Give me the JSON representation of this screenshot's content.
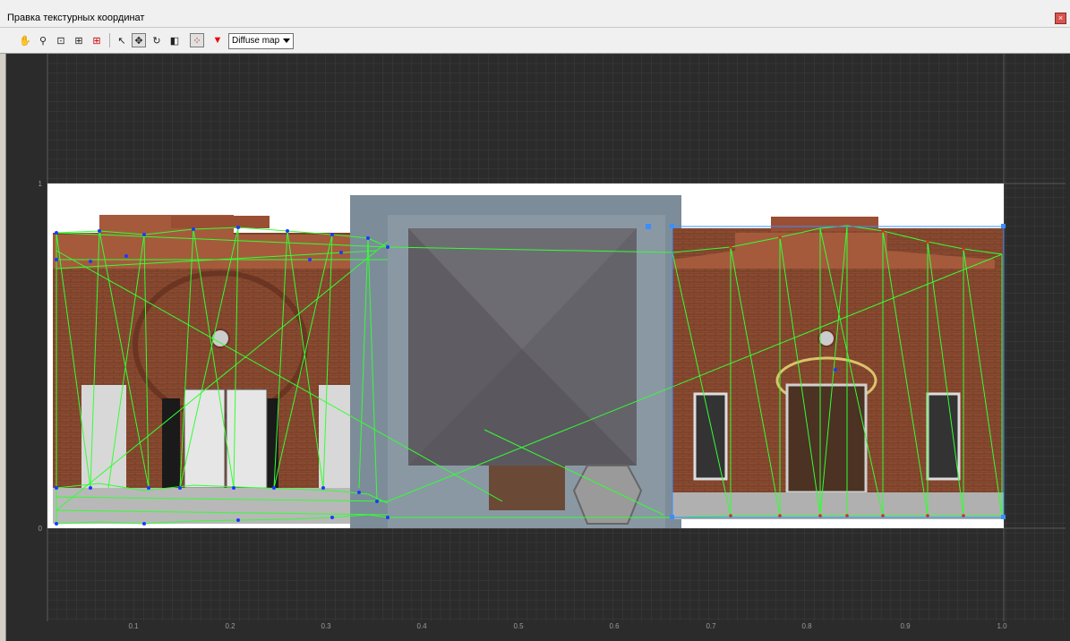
{
  "window": {
    "title": "Правка текстурных координат"
  },
  "toolbar": {
    "tools": [
      "pan-icon",
      "zoom-icon",
      "zoom-region-icon",
      "zoom-extents-icon",
      "zoom-selected-icon",
      "select-icon",
      "move-icon",
      "rotate-icon",
      "scale-icon",
      "vertex-mode-icon",
      "filter-icon"
    ],
    "map_select": {
      "selected": "Diffuse map"
    }
  },
  "uv_grid": {
    "x_ticks": [
      "0.1",
      "0.2",
      "0.3",
      "0.4",
      "0.5",
      "0.6",
      "0.7",
      "0.8",
      "0.9",
      "1.0"
    ],
    "y_ticks": [
      "1",
      "0"
    ]
  },
  "colors": {
    "mesh_edge": "#33ff33",
    "vertex": "#1a3aff",
    "selection_box": "#3a8fff",
    "background": "#2b2b2b",
    "grid": "#555555"
  }
}
